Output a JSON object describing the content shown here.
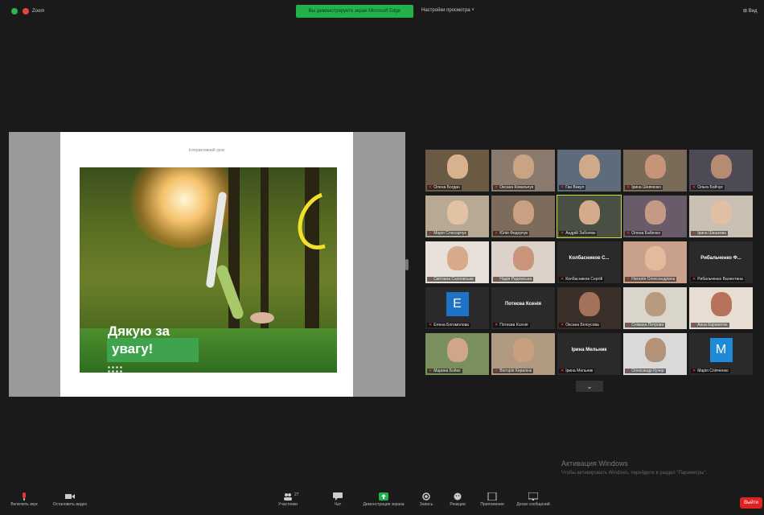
{
  "topbar": {
    "app_label": "Zoom",
    "share_banner": "Вы демонстрируете экран Microsoft Edge",
    "view_options": "Настройки просмотра ˅",
    "view_right": "⊞ Вид"
  },
  "slide": {
    "header": "Інтерактивний урок",
    "thanks_line1": "Дякую за",
    "thanks_line2": "увагу!"
  },
  "participants": [
    {
      "name": "Олена Богдан",
      "kind": "video",
      "bg": "#6b5a43",
      "face": "#d8b28f"
    },
    {
      "name": "Оксана Ковальчук",
      "kind": "video",
      "bg": "#8a7b6e",
      "face": "#caa383"
    },
    {
      "name": "Ган Вакул",
      "kind": "video",
      "bg": "#5d6b7a",
      "face": "#d0a98a"
    },
    {
      "name": "Ірина Шевченко",
      "kind": "video",
      "bg": "#7a6a58",
      "face": "#c69476"
    },
    {
      "name": "Ольга Бойчук",
      "kind": "video",
      "bg": "#4d4a55",
      "face": "#b78a72"
    },
    {
      "name": "Марія Слюсарчук",
      "kind": "video",
      "bg": "#b8a995",
      "face": "#e1c2a2"
    },
    {
      "name": "Юлія Федорчук",
      "kind": "video",
      "bg": "#7d6b5b",
      "face": "#caa082"
    },
    {
      "name": "Андрій Заболюк",
      "kind": "video",
      "bg": "#4a4f43",
      "face": "#d4ac8c"
    },
    {
      "name": "Олена Бабенко",
      "kind": "video",
      "bg": "#6a5b6a",
      "face": "#c49a86"
    },
    {
      "name": "Ірина Шишкова",
      "kind": "video",
      "bg": "#c9bfb2",
      "face": "#e0bfa4"
    },
    {
      "name": "Світлана Сахновська",
      "kind": "video",
      "bg": "#e6e0d8",
      "face": "#d9a98c"
    },
    {
      "name": "Надія Радомська",
      "kind": "video",
      "bg": "#dcd2ca",
      "face": "#c99479"
    },
    {
      "name": "Колбасников С.",
      "kind": "name",
      "label": "Колбасников С...",
      "sub": "Колбасников Сергій"
    },
    {
      "name": "Наталія Олександрівна",
      "kind": "video",
      "bg": "#c9a08a",
      "face": "#e6b99d"
    },
    {
      "name": "Рибальченко Вален.",
      "kind": "name",
      "label": "Рибальченко Ф...",
      "sub": "Рибальченко Валентина"
    },
    {
      "name": "Елена Богомолова",
      "kind": "letter",
      "letter": "E",
      "color": "#1e73c8"
    },
    {
      "name": "Потеєва Ксенія",
      "kind": "name",
      "label": "Потеєва Ксенія",
      "sub": "Потеєва Ксенія"
    },
    {
      "name": "Оксана Білоусова",
      "kind": "video",
      "bg": "#3b2f2a",
      "face": "#a4725a"
    },
    {
      "name": "Сніжана Петрова",
      "kind": "video",
      "bg": "#dad5ca",
      "face": "#b99a80"
    },
    {
      "name": "Анна Карапетян",
      "kind": "video",
      "bg": "#e7ddd3",
      "face": "#b7725c"
    },
    {
      "name": "Марина Бойко",
      "kind": "video",
      "bg": "#7a8f5e",
      "face": "#d0a68a"
    },
    {
      "name": "Вікторія Кирилюк",
      "kind": "video",
      "bg": "#b09a80",
      "face": "#c8a080"
    },
    {
      "name": "Ірина Мельник",
      "kind": "name",
      "label": "Ірина Мельник",
      "sub": "Ірина Мельник"
    },
    {
      "name": "Олександр Кучер",
      "kind": "video",
      "bg": "#d9d9d9",
      "face": "#b39277"
    },
    {
      "name": "Марія Сліпченко",
      "kind": "letter",
      "letter": "M",
      "color": "#1e8ad8"
    }
  ],
  "active_index": 7,
  "more_chevron": "⌄",
  "watermark": {
    "line1": "Активация Windows",
    "line2": "Чтобы активировать Windows, перейдите в раздел \"Параметры\"."
  },
  "toolbar": {
    "mute": "Включить звук",
    "video": "Остановить видео",
    "participants": "Участники",
    "participants_count": "27",
    "chat": "Чат",
    "share": "Демонстрация экрана",
    "record": "Запись",
    "reactions": "Реакции",
    "apps": "Приложения",
    "whiteboard": "Доски сообщений",
    "leave": "Выйти"
  },
  "colors": {
    "banner": "#22b14c",
    "accent_green": "#3fa34d",
    "leave": "#dd2222",
    "arc": "#f2e02a"
  }
}
